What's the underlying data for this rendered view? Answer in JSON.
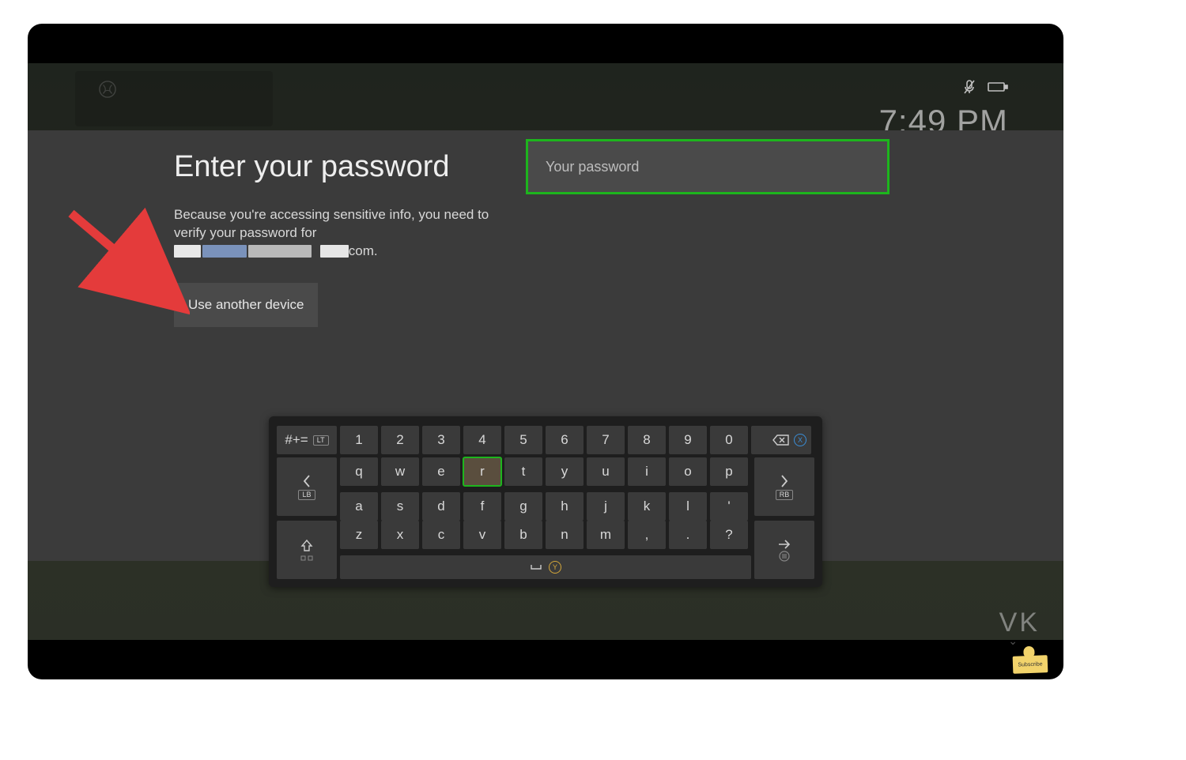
{
  "status": {
    "clock": "7:49 PM",
    "mic_muted_icon": "mic-muted",
    "battery_icon": "battery"
  },
  "dialog": {
    "title": "Enter your password",
    "description_pre": "Because you're accessing sensitive info, you need to verify your password for ",
    "description_post": "com.",
    "alt_button": "Use another device"
  },
  "password_input": {
    "placeholder": "Your password",
    "value": ""
  },
  "keyboard": {
    "symbols_label": "#+=",
    "lt_label": "LT",
    "lb_label": "LB",
    "rb_label": "RB",
    "row_numbers": [
      "1",
      "2",
      "3",
      "4",
      "5",
      "6",
      "7",
      "8",
      "9",
      "0"
    ],
    "row_qwerty": [
      "q",
      "w",
      "e",
      "r",
      "t",
      "y",
      "u",
      "i",
      "o",
      "p"
    ],
    "row_asdf": [
      "a",
      "s",
      "d",
      "f",
      "g",
      "h",
      "j",
      "k",
      "l",
      "'"
    ],
    "row_zxcv": [
      "z",
      "x",
      "c",
      "v",
      "b",
      "n",
      "m",
      ",",
      ".",
      "?"
    ],
    "highlighted_key": "r",
    "space_icon": "space",
    "y_label": "Y",
    "x_label": "X"
  },
  "watermark": {
    "text": "VK",
    "subscribe": "Subscribe"
  }
}
